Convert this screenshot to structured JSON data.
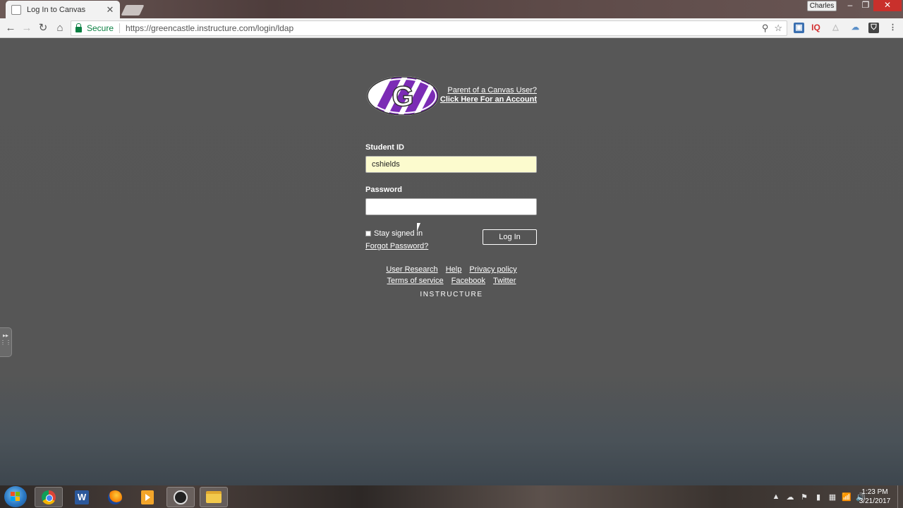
{
  "browser": {
    "tab": {
      "title": "Log In to Canvas",
      "close_glyph": "✕"
    },
    "profile_name": "Charles",
    "window_controls": {
      "minimize": "–",
      "maximize": "❐",
      "close": "✕"
    },
    "nav": {
      "back": "←",
      "forward": "→",
      "reload": "↻",
      "home": "⌂"
    },
    "address": {
      "secure_label": "Secure",
      "url": "https://greencastle.instructure.com/login/ldap",
      "search_icon": "⚲",
      "star_icon": "☆"
    },
    "extensions": [
      {
        "name": "extension-1-icon",
        "glyph": "▣"
      },
      {
        "name": "iq-extension-icon",
        "glyph": "IQ"
      },
      {
        "name": "drive-extension-icon",
        "glyph": "△"
      },
      {
        "name": "cloud-extension-icon",
        "glyph": "☁"
      },
      {
        "name": "shield-extension-icon",
        "glyph": "⛉"
      }
    ],
    "menu_glyph": "⋮"
  },
  "login": {
    "logo_letter": "G",
    "parent_link": "Parent of a Canvas User?",
    "account_link": "Click Here For an Account",
    "student_id_label": "Student ID",
    "student_id_value": "cshields",
    "password_label": "Password",
    "password_value": "",
    "stay_signed_in_label": "Stay signed in",
    "forgot_password_link": "Forgot Password?",
    "login_button": "Log In"
  },
  "footer": {
    "row1": [
      "User Research",
      "Help",
      "Privacy policy"
    ],
    "row2": [
      "Terms of service",
      "Facebook",
      "Twitter"
    ],
    "brand": "INSTRUCTURE"
  },
  "taskbar": {
    "apps": [
      "chrome",
      "word",
      "firefox",
      "media-player",
      "obs",
      "file-explorer"
    ],
    "tray_glyphs": [
      "▲",
      "☁",
      "⚑",
      "▮",
      "▦",
      "📶",
      "🔊"
    ],
    "clock": {
      "time": "1:23 PM",
      "date": "3/21/2017"
    }
  },
  "colors": {
    "page_background": "#575757",
    "autofill_yellow": "#fcfbce",
    "logo_purple": "#7b2bb5",
    "secure_green": "#0b8043"
  }
}
